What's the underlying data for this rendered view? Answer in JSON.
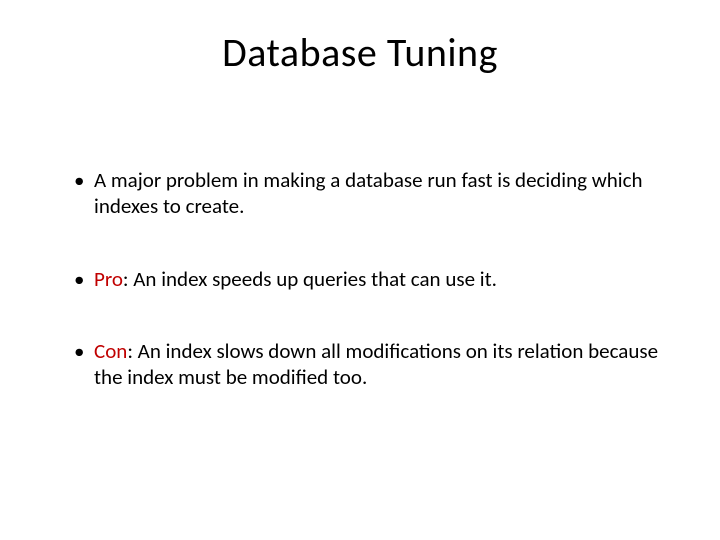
{
  "title": "Database Tuning",
  "bullets": [
    {
      "text": "A major problem in making a database run fast is deciding which indexes to create."
    },
    {
      "label": "Pro",
      "text": ": An index speeds up queries that can use it."
    },
    {
      "label": "Con",
      "text": ": An index slows down all modifications on its relation because the index must be modified too."
    }
  ],
  "colors": {
    "accent": "#c00000"
  }
}
